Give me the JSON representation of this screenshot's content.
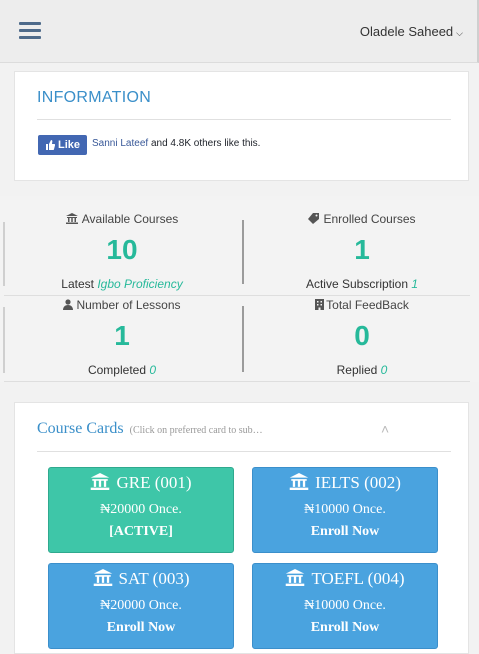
{
  "header": {
    "user_name": "Oladele Saheed",
    "caret": "⌵"
  },
  "info": {
    "title": "INFORMATION",
    "like_label": "Like",
    "friend_name": "Sanni Lateef",
    "like_text": " and 4.8K others like this."
  },
  "stats": {
    "available": {
      "label": "Available Courses",
      "value": "10",
      "sub_prefix": "Latest ",
      "sub_value": "Igbo Proficiency"
    },
    "enrolled": {
      "label": "Enrolled Courses",
      "value": "1",
      "sub_prefix": "Active Subscription ",
      "sub_value": "1"
    },
    "lessons": {
      "label": "Number of Lessons",
      "value": "1",
      "sub_prefix": "Completed ",
      "sub_value": "0"
    },
    "feedback": {
      "label": "Total FeedBack",
      "value": "0",
      "sub_prefix": "Replied ",
      "sub_value": "0"
    }
  },
  "cards_section": {
    "title": "Course Cards",
    "hint": "(Click on preferred card to sub…",
    "chevron": "˄"
  },
  "cards": [
    {
      "title": "GRE (001)",
      "price": "₦20000 Once.",
      "action": "[ACTIVE]",
      "status": "active"
    },
    {
      "title": "IELTS (002)",
      "price": "₦10000 Once.",
      "action": "Enroll Now",
      "status": "available"
    },
    {
      "title": "SAT (003)",
      "price": "₦20000 Once.",
      "action": "Enroll Now",
      "status": "available"
    },
    {
      "title": "TOEFL (004)",
      "price": "₦10000 Once.",
      "action": "Enroll Now",
      "status": "available"
    }
  ],
  "colors": {
    "accent": "#3a8fc9",
    "green": "#26b99a",
    "card_green": "#3ec6a8",
    "card_blue": "#4aa3df"
  }
}
